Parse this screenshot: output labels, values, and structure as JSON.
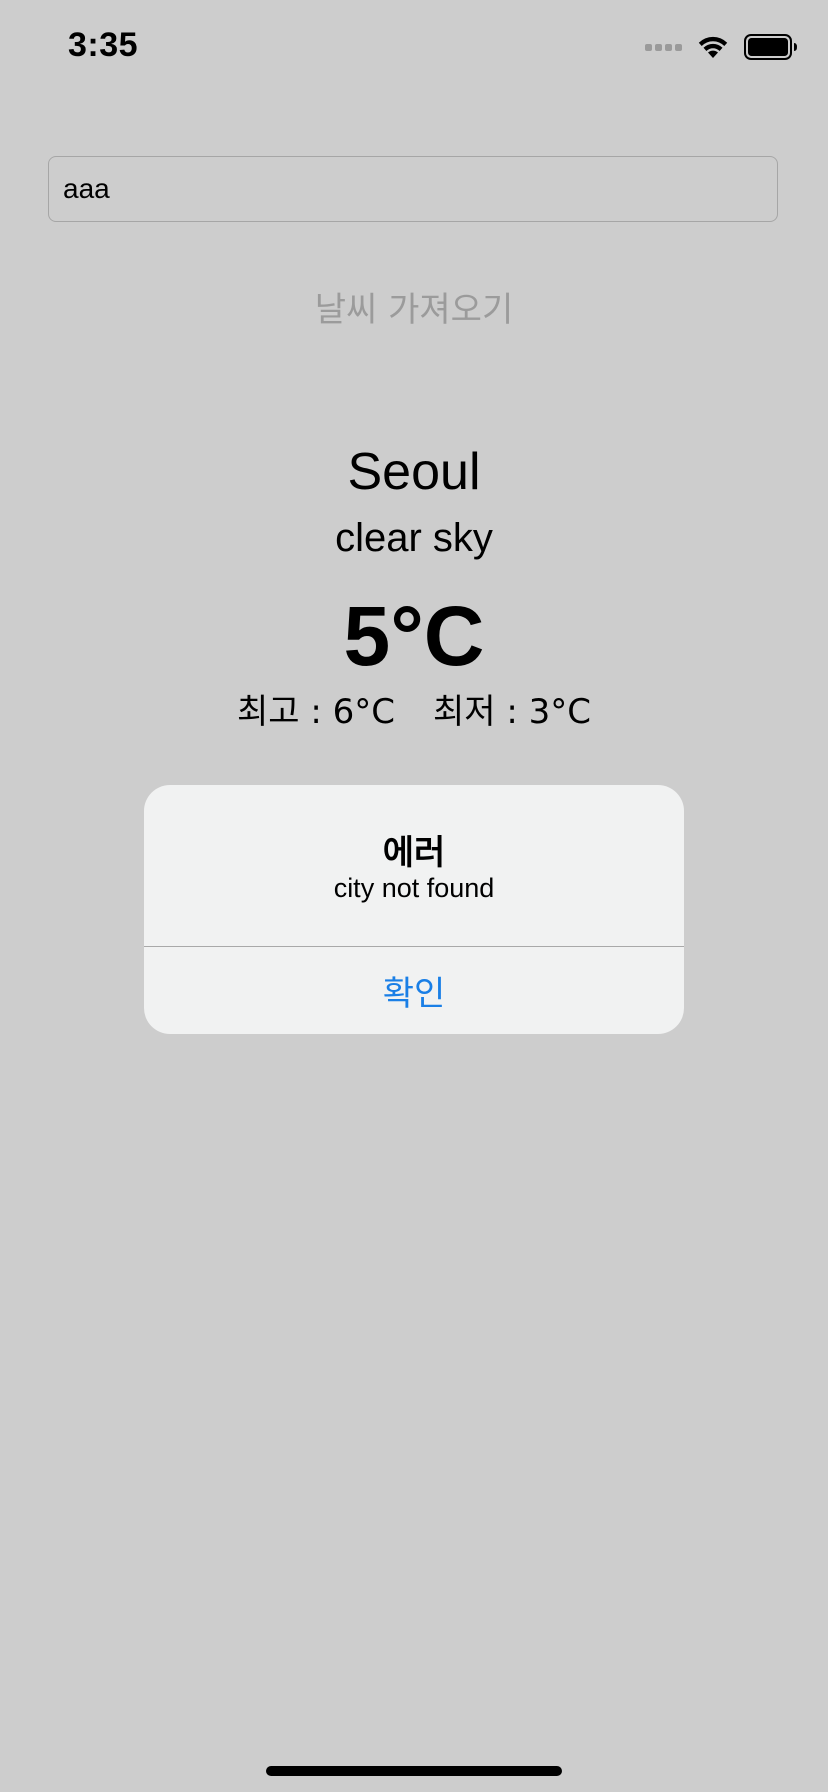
{
  "status_bar": {
    "time": "3:35"
  },
  "search": {
    "value": "aaa",
    "placeholder": ""
  },
  "fetch_button": {
    "label": "날씨 가져오기"
  },
  "weather": {
    "city": "Seoul",
    "description": "clear sky",
    "temperature": "5°C",
    "max": "최고 : 6°C",
    "min": "최저 : 3°C"
  },
  "alert": {
    "title": "에러",
    "message": "city not found",
    "ok_label": "확인"
  },
  "colors": {
    "background": "#cdcdcd",
    "alert_background": "#f1f2f2",
    "accent": "#1a7fe6",
    "disabled_text": "#9b9b9b"
  }
}
